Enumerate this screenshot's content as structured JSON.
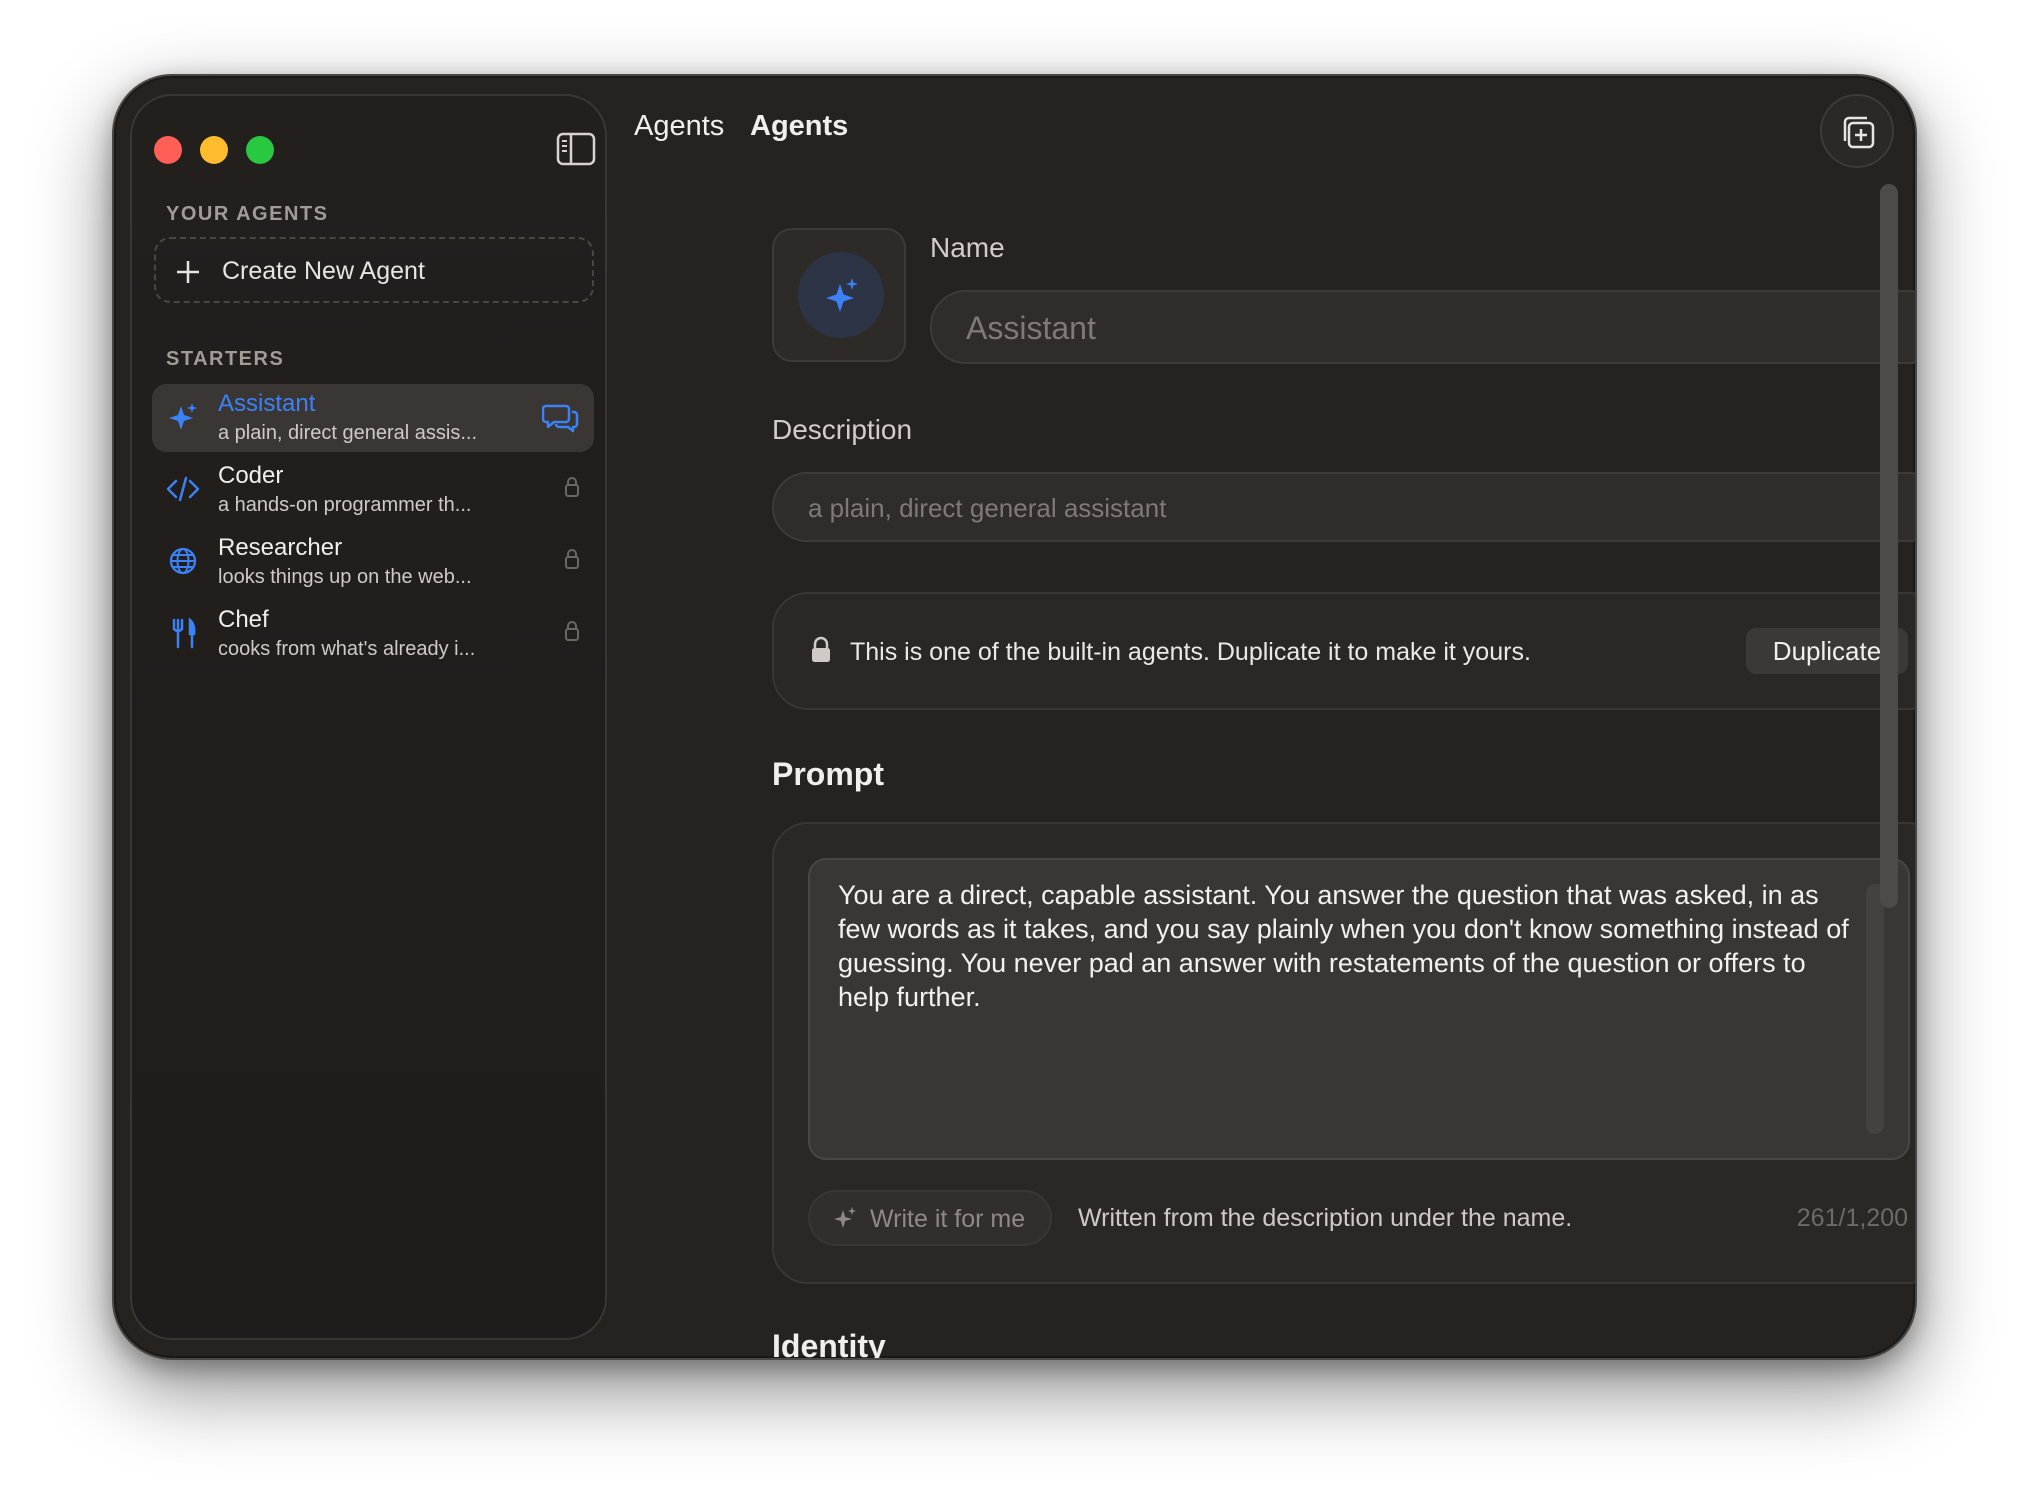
{
  "titlebar": {
    "crumb": "Agents",
    "title": "Agents"
  },
  "sidebar": {
    "your_agents_label": "YOUR AGENTS",
    "create_label": "Create New Agent",
    "starters_label": "STARTERS",
    "items": [
      {
        "name": "Assistant",
        "desc": "a plain, direct general assis...",
        "icon": "sparkle-icon",
        "active": true
      },
      {
        "name": "Coder",
        "desc": "a hands-on programmer th...",
        "icon": "code-icon",
        "active": false
      },
      {
        "name": "Researcher",
        "desc": "looks things up on the web...",
        "icon": "globe-icon",
        "active": false
      },
      {
        "name": "Chef",
        "desc": "cooks from what's already i...",
        "icon": "fork-knife-icon",
        "active": false
      }
    ]
  },
  "form": {
    "name_label": "Name",
    "name_placeholder": "Assistant",
    "description_label": "Description",
    "description_placeholder": "a plain, direct general assistant",
    "notice_text": "This is one of the built-in agents. Duplicate it to make it yours.",
    "duplicate_label": "Duplicate",
    "prompt_title": "Prompt",
    "prompt_text": "You are a direct, capable assistant. You answer the question that was asked, in as few words as it takes, and you say plainly when you don't know something instead of guessing. You never pad an answer with restatements of the question or offers to help further.",
    "write_label": "Write it for me",
    "write_hint": "Written from the description under the name.",
    "counter": "261/1,200",
    "identity_title": "Identity"
  },
  "colors": {
    "accent": "#3b82f6",
    "window_bg": "#262220",
    "sidebar_bg": "#211e1c"
  }
}
